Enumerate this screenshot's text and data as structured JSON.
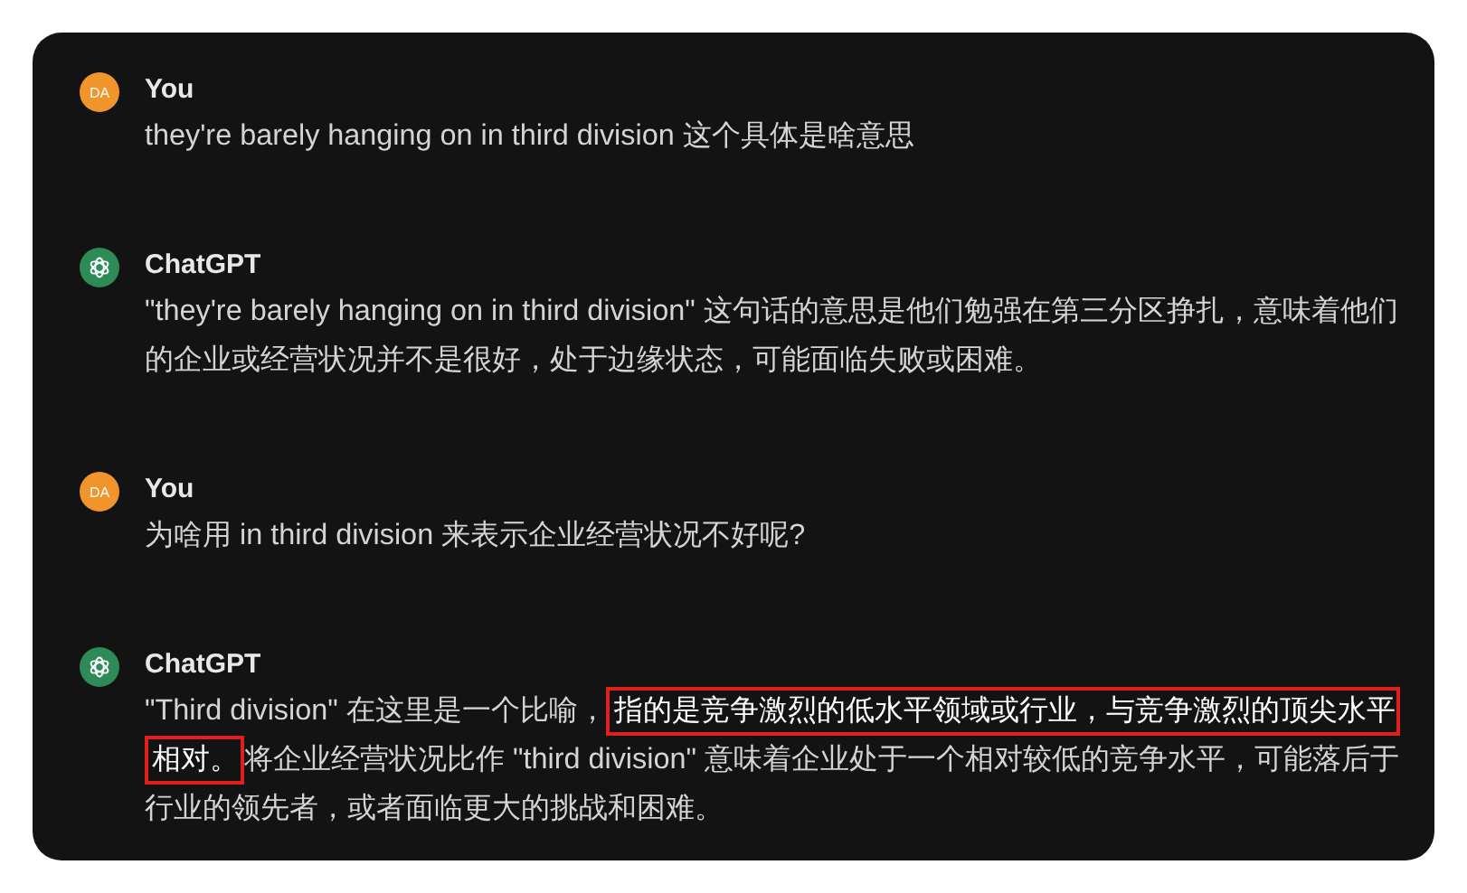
{
  "messages": [
    {
      "kind": "user",
      "avatar": "DA",
      "author": "You",
      "segments": [
        {
          "text": "they're barely hanging on in third division 这个具体是啥意思",
          "highlighted": false
        }
      ]
    },
    {
      "kind": "assistant",
      "author": "ChatGPT",
      "segments": [
        {
          "text": "\"they're barely hanging on in third division\" 这句话的意思是他们勉强在第三分区挣扎，意味着他们的企业或经营状况并不是很好，处于边缘状态，可能面临失败或困难。",
          "highlighted": false
        }
      ]
    },
    {
      "kind": "user",
      "avatar": "DA",
      "author": "You",
      "segments": [
        {
          "text": "为啥用 in third division 来表示企业经营状况不好呢?",
          "highlighted": false
        }
      ]
    },
    {
      "kind": "assistant",
      "author": "ChatGPT",
      "segments": [
        {
          "text": "\"Third division\" 在这里是一个比喻，",
          "highlighted": false
        },
        {
          "text": "指的是竞争激烈的低水平领域或行业，与竞争激烈的顶尖水平相对。",
          "highlighted": true
        },
        {
          "text": "将企业经营状况比作 \"third division\" 意味着企业处于一个相对较低的竞争水平，可能落后于行业的领先者，或者面临更大的挑战和困难。",
          "highlighted": false
        }
      ]
    }
  ]
}
